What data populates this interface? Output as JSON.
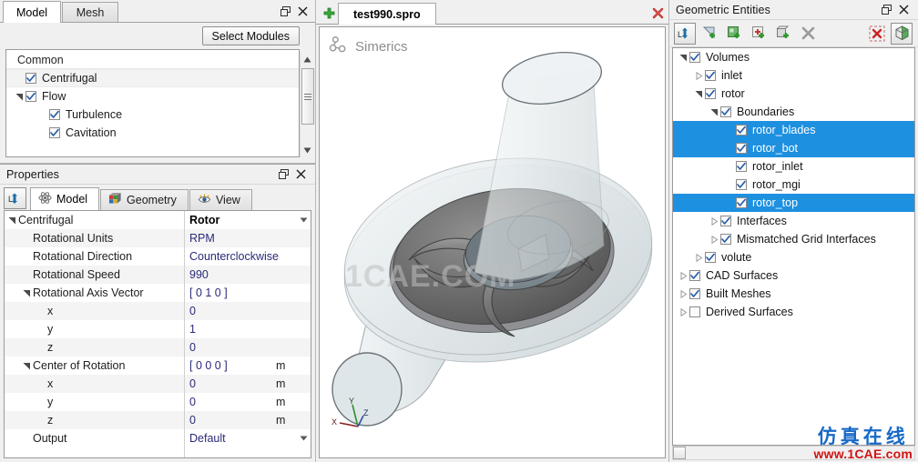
{
  "model_panel": {
    "tabs": [
      {
        "label": "Model",
        "active": true
      },
      {
        "label": "Mesh",
        "active": false
      }
    ],
    "select_modules_label": "Select Modules",
    "list": [
      {
        "label": "Common",
        "type": "header",
        "indent": 0,
        "checked": null,
        "expander": null
      },
      {
        "label": "Centrifugal",
        "type": "item",
        "indent": 1,
        "checked": true,
        "expander": null
      },
      {
        "label": "Flow",
        "type": "item",
        "indent": 1,
        "checked": true,
        "expander": "expanded"
      },
      {
        "label": "Turbulence",
        "type": "item",
        "indent": 2,
        "checked": true,
        "expander": null
      },
      {
        "label": "Cavitation",
        "type": "item",
        "indent": 2,
        "checked": true,
        "expander": null
      }
    ]
  },
  "properties_panel": {
    "title": "Properties",
    "dock_icon": "dock-pin-icon",
    "tabs": [
      {
        "label": "Model",
        "icon": "atom-icon",
        "active": true
      },
      {
        "label": "Geometry",
        "icon": "cube-color-icon",
        "active": false
      },
      {
        "label": "View",
        "icon": "eye-icon",
        "active": false
      }
    ],
    "rows": [
      {
        "name": "Centrifugal",
        "value": "Rotor",
        "unit": "",
        "indent": 0,
        "expander": "expanded",
        "bold": true,
        "dropdown": true
      },
      {
        "name": "Rotational Units",
        "value": "RPM",
        "unit": "",
        "indent": 1,
        "expander": null,
        "bold": false,
        "dropdown": false
      },
      {
        "name": "Rotational Direction",
        "value": "Counterclockwise",
        "unit": "",
        "indent": 1,
        "expander": null,
        "bold": false,
        "dropdown": false
      },
      {
        "name": "Rotational Speed",
        "value": "990",
        "unit": "",
        "indent": 1,
        "expander": null,
        "bold": false,
        "dropdown": false
      },
      {
        "name": "Rotational Axis Vector",
        "value": "[ 0 1 0 ]",
        "unit": "",
        "indent": 1,
        "expander": "expanded",
        "bold": false,
        "dropdown": false
      },
      {
        "name": "x",
        "value": "0",
        "unit": "",
        "indent": 2,
        "expander": null,
        "bold": false,
        "dropdown": false
      },
      {
        "name": "y",
        "value": "1",
        "unit": "",
        "indent": 2,
        "expander": null,
        "bold": false,
        "dropdown": false
      },
      {
        "name": "z",
        "value": "0",
        "unit": "",
        "indent": 2,
        "expander": null,
        "bold": false,
        "dropdown": false
      },
      {
        "name": "Center of Rotation",
        "value": "[ 0 0 0 ]",
        "unit": "m",
        "indent": 1,
        "expander": "expanded",
        "bold": false,
        "dropdown": false
      },
      {
        "name": "x",
        "value": "0",
        "unit": "m",
        "indent": 2,
        "expander": null,
        "bold": false,
        "dropdown": false
      },
      {
        "name": "y",
        "value": "0",
        "unit": "m",
        "indent": 2,
        "expander": null,
        "bold": false,
        "dropdown": false
      },
      {
        "name": "z",
        "value": "0",
        "unit": "m",
        "indent": 2,
        "expander": null,
        "bold": false,
        "dropdown": false
      },
      {
        "name": "Output",
        "value": "Default",
        "unit": "",
        "indent": 1,
        "expander": null,
        "bold": false,
        "dropdown": true
      }
    ]
  },
  "viewport": {
    "document_tab": "test990.spro",
    "new_tab_icon": "plus-icon",
    "close_icon": "close-red-icon",
    "logo_text": "Simerics",
    "logo_icon": "simerics-molecule-icon",
    "watermark": "1CAE.COM",
    "axis_labels": {
      "x": "X",
      "y": "Y",
      "z": "Z"
    }
  },
  "geometric_entities": {
    "title": "Geometric Entities",
    "toolbar": [
      {
        "icon": "dock-pin-icon",
        "pressed": true
      },
      {
        "icon": "add-surface-icon",
        "pressed": false
      },
      {
        "icon": "add-sketch-icon",
        "pressed": false
      },
      {
        "icon": "add-point-icon",
        "pressed": false
      },
      {
        "icon": "add-volume-icon",
        "pressed": false
      },
      {
        "icon": "delete-x-icon",
        "pressed": false
      },
      {
        "icon": "clear-selection-icon",
        "pressed": false
      },
      {
        "icon": "show-geometry-cube-icon",
        "pressed": true
      }
    ],
    "tree": [
      {
        "label": "Volumes",
        "indent": 0,
        "expander": "expanded",
        "checked": true,
        "selected": false
      },
      {
        "label": "inlet",
        "indent": 1,
        "expander": "collapsed",
        "checked": true,
        "selected": false
      },
      {
        "label": "rotor",
        "indent": 1,
        "expander": "expanded",
        "checked": true,
        "selected": false
      },
      {
        "label": "Boundaries",
        "indent": 2,
        "expander": "expanded",
        "checked": true,
        "selected": false
      },
      {
        "label": "rotor_blades",
        "indent": 3,
        "expander": null,
        "checked": true,
        "selected": true
      },
      {
        "label": "rotor_bot",
        "indent": 3,
        "expander": null,
        "checked": true,
        "selected": true
      },
      {
        "label": "rotor_inlet",
        "indent": 3,
        "expander": null,
        "checked": true,
        "selected": false
      },
      {
        "label": "rotor_mgi",
        "indent": 3,
        "expander": null,
        "checked": true,
        "selected": false
      },
      {
        "label": "rotor_top",
        "indent": 3,
        "expander": null,
        "checked": true,
        "selected": true
      },
      {
        "label": "Interfaces",
        "indent": 2,
        "expander": "collapsed",
        "checked": true,
        "selected": false
      },
      {
        "label": "Mismatched Grid Interfaces",
        "indent": 2,
        "expander": "collapsed",
        "checked": true,
        "selected": false
      },
      {
        "label": "volute",
        "indent": 1,
        "expander": "collapsed",
        "checked": true,
        "selected": false
      },
      {
        "label": "CAD Surfaces",
        "indent": 0,
        "expander": "collapsed",
        "checked": true,
        "selected": false
      },
      {
        "label": "Built Meshes",
        "indent": 0,
        "expander": "collapsed",
        "checked": true,
        "selected": false
      },
      {
        "label": "Derived Surfaces",
        "indent": 0,
        "expander": "collapsed",
        "checked": false,
        "selected": false
      }
    ]
  },
  "watermark_bottom_right": {
    "chinese": "仿真在线",
    "url": "www.1CAE.com"
  },
  "colors": {
    "selection_blue": "#1e90e0",
    "value_text": "#2a2a7a",
    "watermark_blue": "#1769c7",
    "watermark_red": "#d01414"
  }
}
